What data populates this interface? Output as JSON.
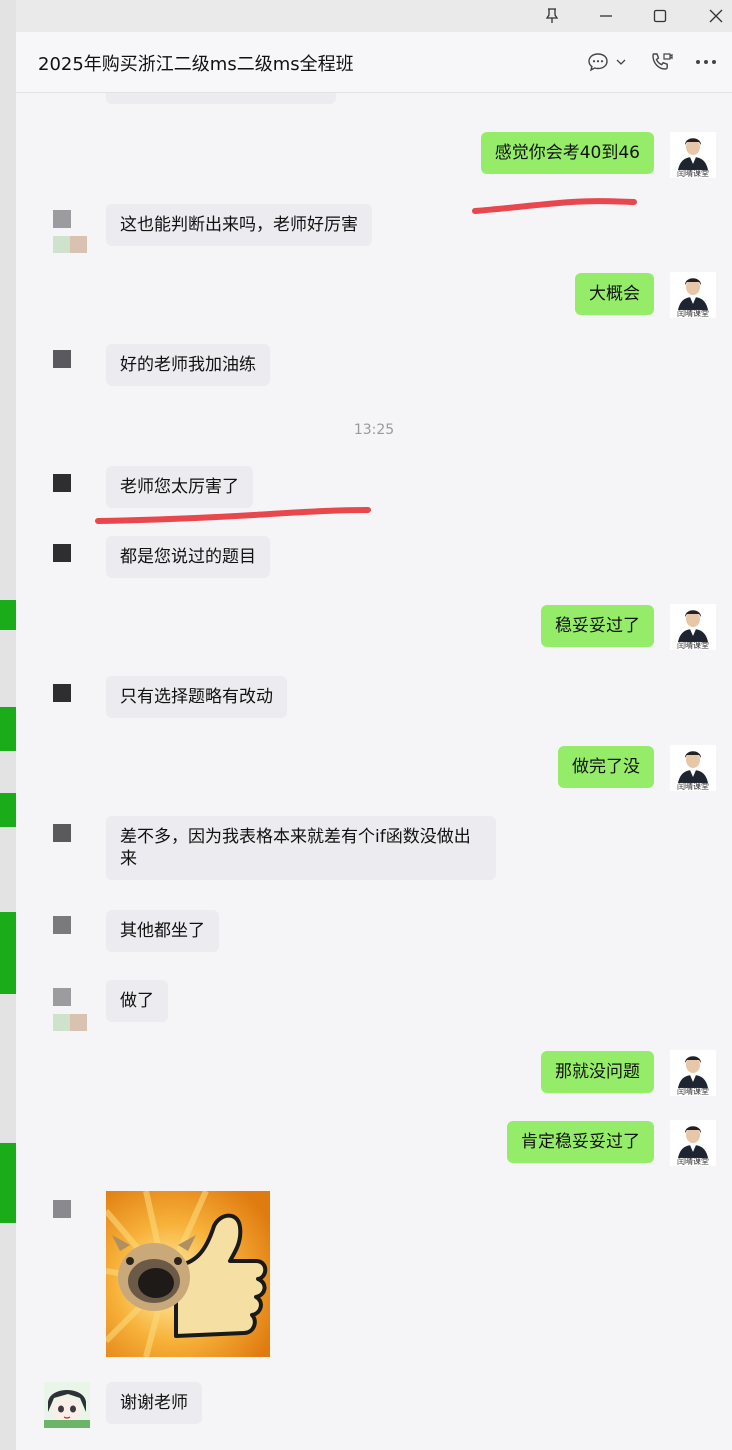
{
  "window": {
    "title": "2025年购买浙江二级ms二级ms全程班",
    "buttons": [
      "pin-icon",
      "minimize-icon",
      "maximize-icon",
      "close-icon"
    ]
  },
  "header_icons": [
    "chat-bubble-icon",
    "chevron-down-icon",
    "phone-icon",
    "more-icon"
  ],
  "colors": {
    "outgoing": "#95ec69",
    "incoming": "#ececf0",
    "underline": "#e8474d",
    "strip_accent": "#1aad19"
  },
  "messages": [
    {
      "side": "out",
      "text": "感觉你会考40到46"
    },
    {
      "side": "in",
      "text": "这也能判断出来吗，老师好厉害"
    },
    {
      "side": "out",
      "text": "大概会"
    },
    {
      "side": "in",
      "text": "好的老师我加油练"
    },
    {
      "side": "time",
      "text": "13:25"
    },
    {
      "side": "in",
      "text": "老师您太厉害了"
    },
    {
      "side": "in",
      "text": "都是您说过的题目"
    },
    {
      "side": "out",
      "text": "稳妥妥过了"
    },
    {
      "side": "in",
      "text": "只有选择题略有改动"
    },
    {
      "side": "out",
      "text": "做完了没"
    },
    {
      "side": "in",
      "text": "差不多，因为我表格本来就差有个if函数没做出来"
    },
    {
      "side": "in",
      "text": "其他都坐了"
    },
    {
      "side": "in",
      "text": "做了"
    },
    {
      "side": "out",
      "text": "那就没问题"
    },
    {
      "side": "out",
      "text": "肯定稳妥妥过了"
    },
    {
      "side": "in",
      "image": "thumbs-up-dog-sticker"
    },
    {
      "side": "in",
      "text": "谢谢老师"
    }
  ],
  "avatar_caption": "闰晴课堂"
}
